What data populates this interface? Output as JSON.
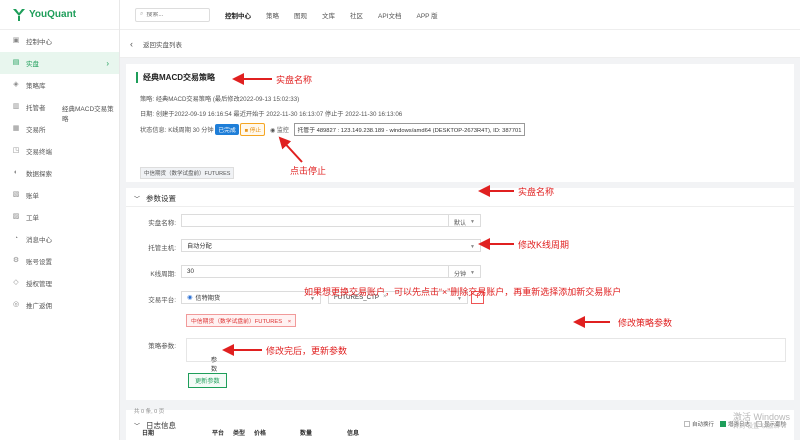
{
  "app": {
    "logo_text": "YouQuant",
    "brand_color": "#1e9e5a"
  },
  "search": {
    "placeholder": "搜索..."
  },
  "nav": [
    "控制中心",
    "策略",
    "图观",
    "文库",
    "社区",
    "API文档",
    "APP 版"
  ],
  "sidebar": {
    "items": [
      {
        "label": "控制中心",
        "icon": "dashboard-icon"
      },
      {
        "label": "实盘",
        "icon": "robot-icon"
      },
      {
        "label": "策略库",
        "icon": "strategy-icon"
      },
      {
        "label": "托管者",
        "icon": "server-icon"
      },
      {
        "label": "交易所",
        "icon": "bank-icon"
      },
      {
        "label": "交易终端",
        "icon": "terminal-icon"
      },
      {
        "label": "数据探索",
        "icon": "database-icon"
      },
      {
        "label": "账单",
        "icon": "bill-icon"
      },
      {
        "label": "工单",
        "icon": "ticket-icon"
      },
      {
        "label": "消息中心",
        "icon": "bell-icon"
      },
      {
        "label": "账号设置",
        "icon": "gear-icon"
      },
      {
        "label": "授权管理",
        "icon": "key-icon"
      },
      {
        "label": "推广返佣",
        "icon": "share-icon"
      }
    ],
    "flyout": "经典MACD交易策略"
  },
  "back": {
    "label": "返回实盘列表"
  },
  "strategy": {
    "title": "经典MACD交易策略",
    "line1": "策略: 经典MACD交易策略 (最后修改2022-09-13 15:02:33)",
    "line2": "日期: 创建于2022-09-19 16:16:54 最近开始于 2022-11-30 16:13:07 停止于 2022-11-30 16:13:06",
    "status_label": "状态信息:",
    "kline": "K线周期 30 分钟",
    "status_tag": "已完成",
    "stop_btn": "■ 停止",
    "monitor": "监控",
    "host": "托管于 489827 : 123.149.238.189 - windows/amd64 (DESKTOP-2673R4T), ID: 387701",
    "exchange_tag": "中信期货（数学试盘前）FUTURES"
  },
  "params": {
    "section_title": "参数设置",
    "name_label": "实盘名称:",
    "name_value": "",
    "name_suffix": "默认",
    "host_label": "托管主机:",
    "host_value": "自动分配",
    "kline_label": "K线周期:",
    "kline_value": "30",
    "kline_unit": "分钟",
    "platform_label": "交易平台:",
    "platform_value": "信特期货",
    "symbol_value": "FUTURES_CTP",
    "exchange_chip": "中信期货（数学试盘前）FUTURES",
    "strategy_params_label": "策略参数:",
    "params_expand": "参数",
    "update_btn": "更新参数"
  },
  "log": {
    "section_title": "日志信息",
    "sub": "共 0 条, 0 页",
    "opts": [
      "自动换行",
      "增强日志",
      "显示毫秒"
    ],
    "columns": [
      "日期",
      "平台",
      "类型",
      "价格",
      "数量",
      "信息"
    ]
  },
  "annotations": {
    "name_title": "实盘名称",
    "click_stop": "点击停止",
    "name_field": "实盘名称",
    "kline": "修改K线周期",
    "exchange": "如果想更换交易账户，可以先点击“×”删除交易账户，再重新选择添加新交易账户",
    "params": "修改策略参数",
    "update": "修改完后，更新参数"
  },
  "watermark": {
    "line1": "激活 Windows",
    "line2": "转到\"设置\"以激活 W"
  }
}
